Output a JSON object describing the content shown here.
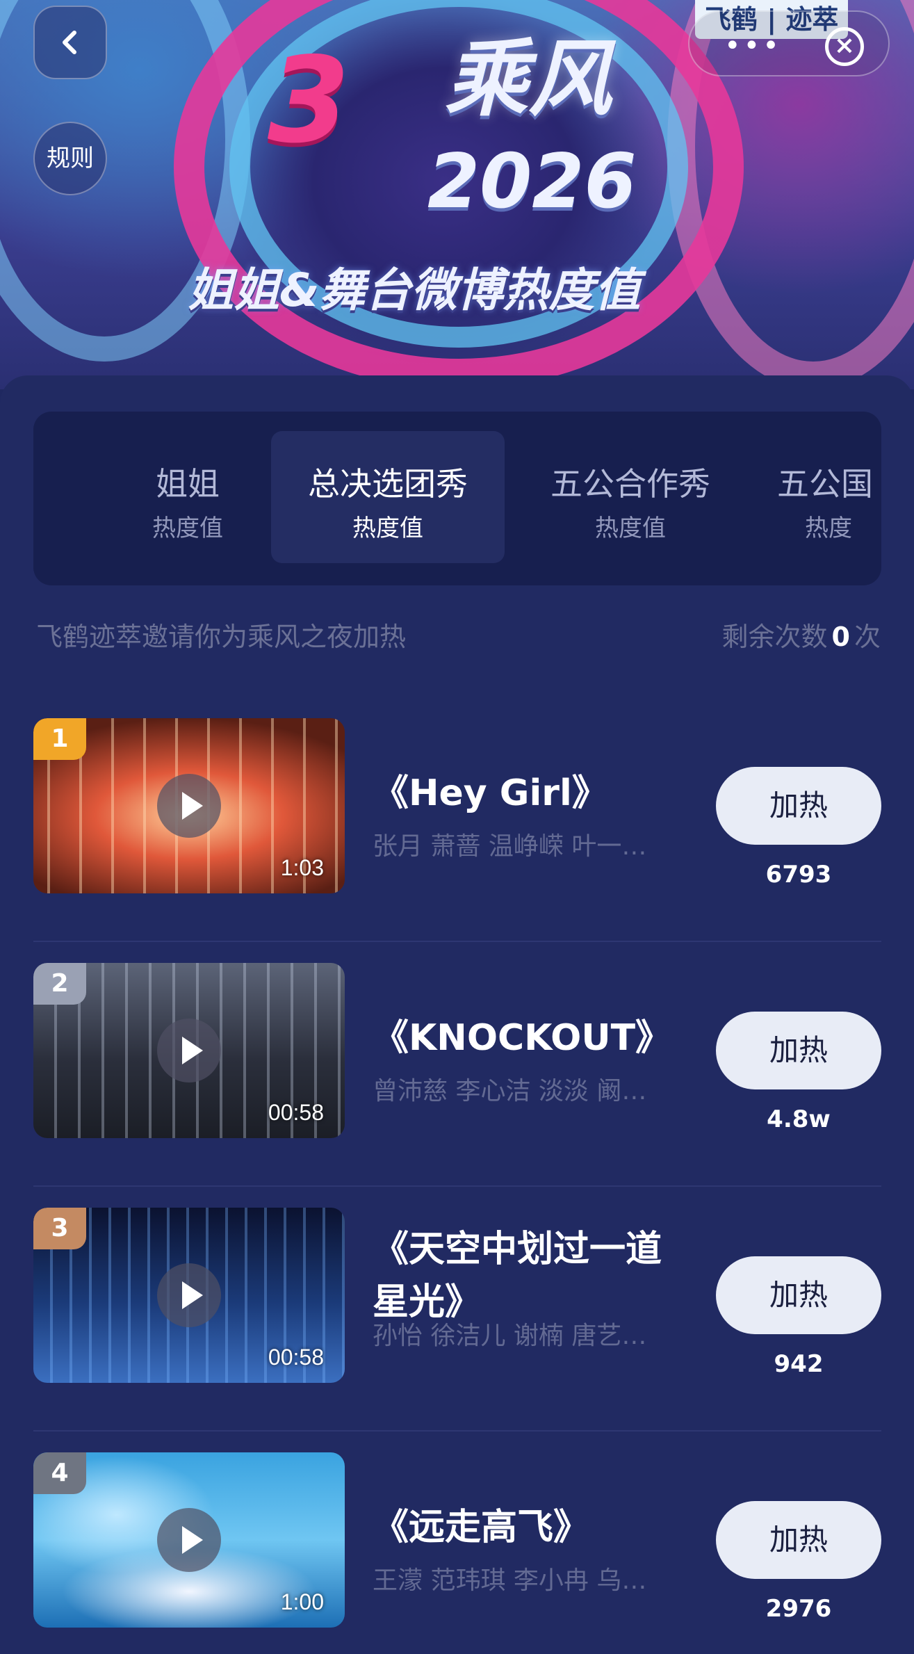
{
  "banner": {
    "logo_mark": "3",
    "logo_title": "乘风",
    "logo_year": "2026",
    "subtitle": "姐姐&舞台微博热度值",
    "brand_badge": "飞鹤 | 迹萃",
    "rules_label": "规则",
    "more_glyph": "•••",
    "close_glyph": "×"
  },
  "tabs": [
    {
      "title": "姐姐",
      "subtitle": "热度值",
      "active": false
    },
    {
      "title": "总决选团秀",
      "subtitle": "热度值",
      "active": true
    },
    {
      "title": "五公合作秀",
      "subtitle": "热度值",
      "active": false
    },
    {
      "title": "五公国",
      "subtitle": "热度",
      "active": false
    }
  ],
  "invite_text": "飞鹤迹萃邀请你为乘风之夜加热",
  "remaining": {
    "prefix": "剩余次数",
    "count": "0",
    "suffix": "次"
  },
  "items": [
    {
      "rank": "1",
      "title": "《Hey Girl》",
      "artists": "张月 萧蔷 温峥嵘 叶一…",
      "duration": "1:03",
      "button": "加热",
      "heat": "6793",
      "rank_color": "#f1a628"
    },
    {
      "rank": "2",
      "title": "《KNOCKOUT》",
      "artists": "曾沛慈 李心洁 淡淡 阚…",
      "duration": "00:58",
      "button": "加热",
      "heat": "4.8w",
      "rank_color": "#9aa1b4"
    },
    {
      "rank": "3",
      "title": "《天空中划过一道星光》",
      "artists": "孙怡 徐洁儿 谢楠 唐艺…",
      "duration": "00:58",
      "button": "加热",
      "heat": "942",
      "rank_color": "#c48a62"
    },
    {
      "rank": "4",
      "title": "《远走高飞》",
      "artists": "王濛 范玮琪 李小冉 乌…",
      "duration": "1:00",
      "button": "加热",
      "heat": "2976",
      "rank_color": "#6f7582"
    }
  ],
  "colors": {
    "background": "#1f2860",
    "tab_bar": "#171f4f",
    "button_bg": "#e8ecf6",
    "muted_text": "#636a93"
  },
  "icons": [
    "back-chevron-icon",
    "more-dots-icon",
    "close-icon",
    "play-icon"
  ]
}
